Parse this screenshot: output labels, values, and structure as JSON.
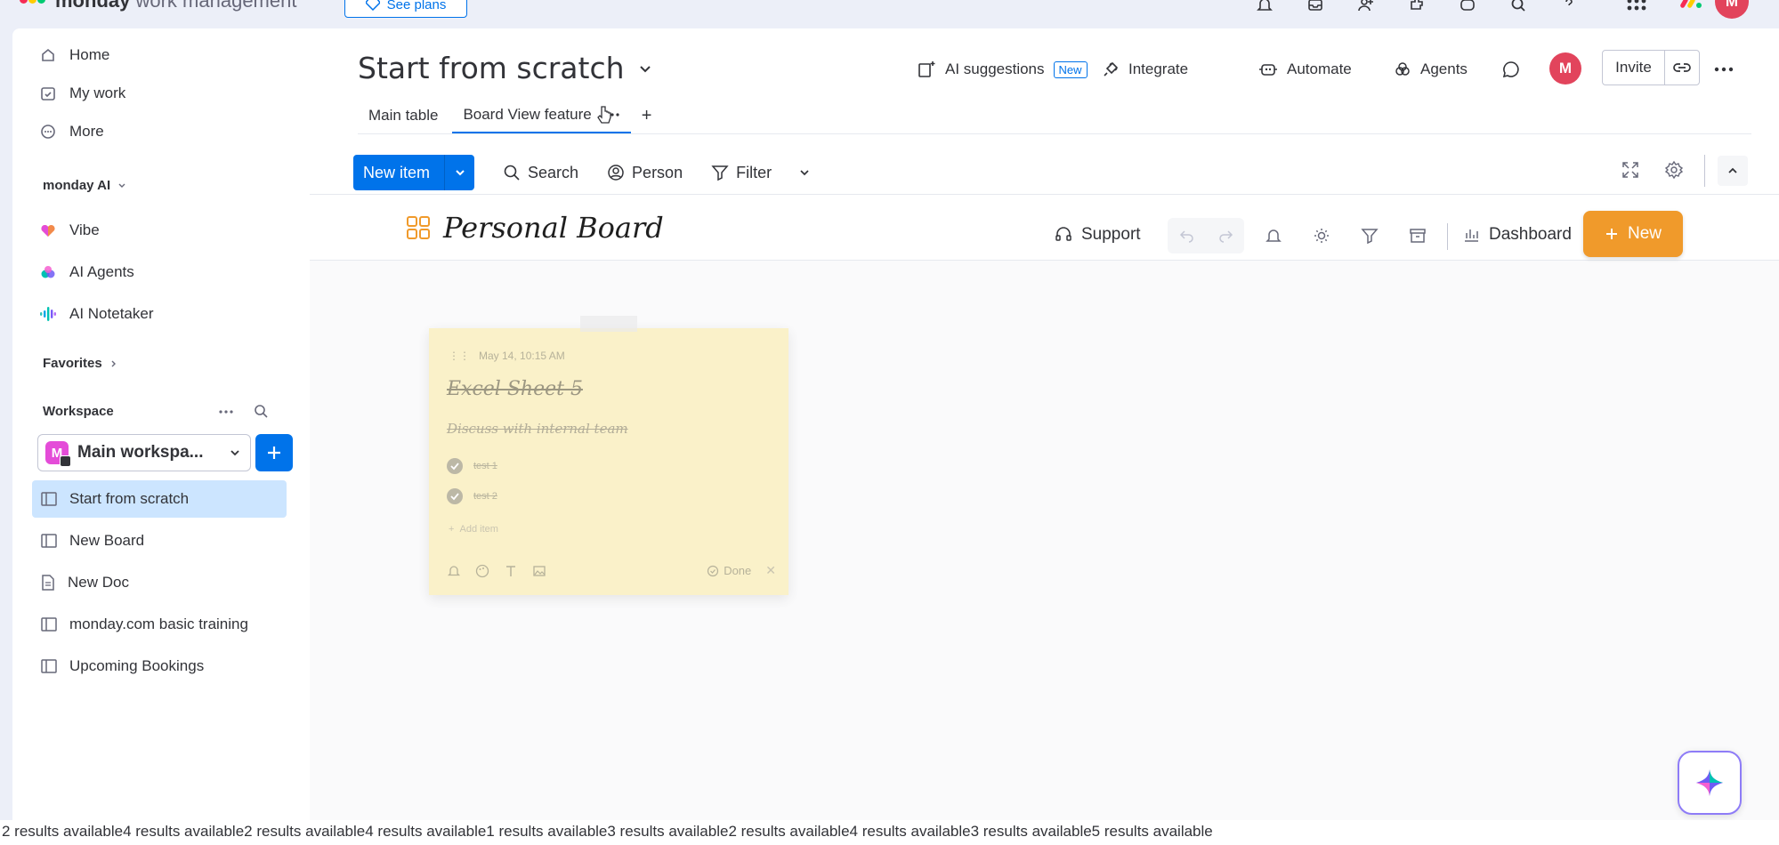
{
  "topbar": {
    "logo_brand": "monday",
    "logo_suffix": "work management",
    "see_plans": "See plans",
    "avatar_initial": "M"
  },
  "sidebar": {
    "nav": [
      {
        "label": "Home",
        "icon": "home-icon"
      },
      {
        "label": "My work",
        "icon": "calendar-check-icon"
      },
      {
        "label": "More",
        "icon": "more-circle-icon"
      }
    ],
    "ai_heading": "monday AI",
    "ai_items": [
      {
        "label": "Vibe",
        "icon": "vibe-heart-icon"
      },
      {
        "label": "AI Agents",
        "icon": "ai-agents-icon"
      },
      {
        "label": "AI Notetaker",
        "icon": "ai-notetaker-icon"
      }
    ],
    "favorites": "Favorites",
    "workspace_heading": "Workspace",
    "workspace_name": "Main workspa...",
    "workspace_badge": "M",
    "boards": [
      {
        "label": "Start from scratch",
        "icon": "board-icon",
        "active": true
      },
      {
        "label": "New Board",
        "icon": "board-icon",
        "active": false
      },
      {
        "label": "New Doc",
        "icon": "doc-icon",
        "active": false
      },
      {
        "label": "monday.com basic training",
        "icon": "board-icon",
        "active": false
      },
      {
        "label": "Upcoming Bookings",
        "icon": "board-icon",
        "active": false
      }
    ]
  },
  "main": {
    "title": "Start from scratch",
    "actions": {
      "ai_suggestions": "AI suggestions",
      "new_tag": "New",
      "integrate": "Integrate",
      "automate": "Automate",
      "agents": "Agents",
      "avatar": "M",
      "invite": "Invite"
    },
    "tabs": [
      {
        "label": "Main table"
      },
      {
        "label": "Board View feature"
      }
    ],
    "add_tab": "+",
    "toolbar": {
      "new_item": "New item",
      "search": "Search",
      "person": "Person",
      "filter": "Filter"
    },
    "personal_board": {
      "title": "Personal Board",
      "support": "Support",
      "dashboard": "Dashboard",
      "new": "New"
    },
    "note": {
      "date": "May 14, 10:15 AM",
      "title": "Excel Sheet 5",
      "description": "Discuss with internal team",
      "items": [
        "test 1",
        "test 2"
      ],
      "add_item": "Add item",
      "done": "Done"
    }
  },
  "accessibility_text": "2 results available4 results available2 results available4 results available1 results available3 results available2 results available4 results available3 results available5 results available",
  "colors": {
    "primary": "#0073ea",
    "orange": "#f09a2b",
    "avatar": "#e2445c",
    "active_board": "#cce5ff",
    "note": "#fbeeb9"
  }
}
